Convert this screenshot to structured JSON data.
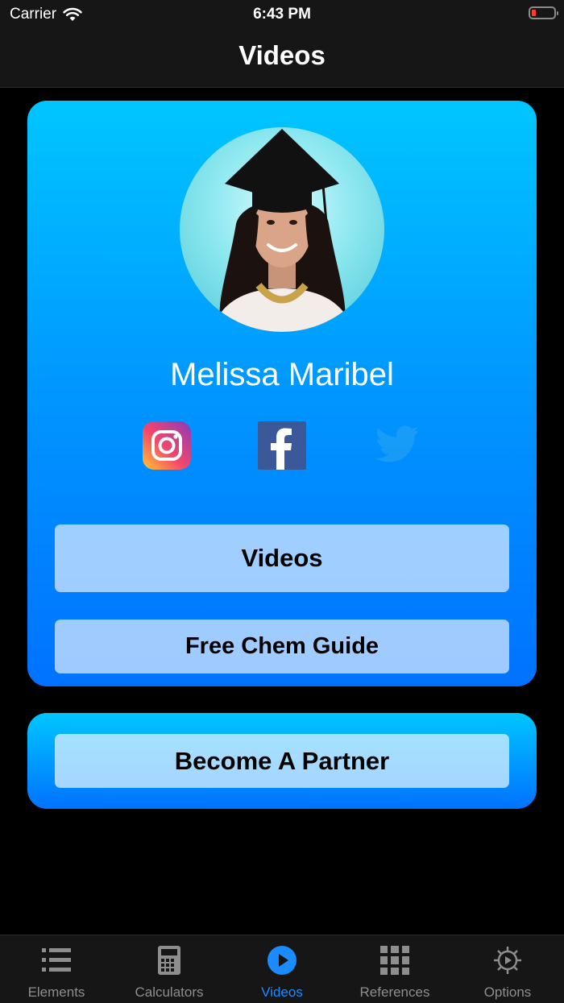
{
  "status_bar": {
    "carrier": "Carrier",
    "time": "6:43 PM"
  },
  "nav": {
    "title": "Videos"
  },
  "profile": {
    "name": "Melissa Maribel",
    "social": [
      {
        "name": "instagram",
        "icon": "instagram-icon"
      },
      {
        "name": "facebook",
        "icon": "facebook-icon"
      },
      {
        "name": "twitter",
        "icon": "twitter-icon"
      }
    ],
    "videos_button": "Videos",
    "guide_button": "Free Chem Guide"
  },
  "partner": {
    "button": "Become A Partner"
  },
  "tabs": [
    {
      "label": "Elements",
      "icon": "list-icon",
      "active": false
    },
    {
      "label": "Calculators",
      "icon": "calculator-icon",
      "active": false
    },
    {
      "label": "Videos",
      "icon": "play-icon",
      "active": true
    },
    {
      "label": "References",
      "icon": "grid-icon",
      "active": false
    },
    {
      "label": "Options",
      "icon": "gear-icon",
      "active": false
    }
  ],
  "colors": {
    "accent": "#1a8cff",
    "card_top": "#00c6ff",
    "card_bottom": "#0072ff",
    "battery_low": "#ff3b30"
  }
}
